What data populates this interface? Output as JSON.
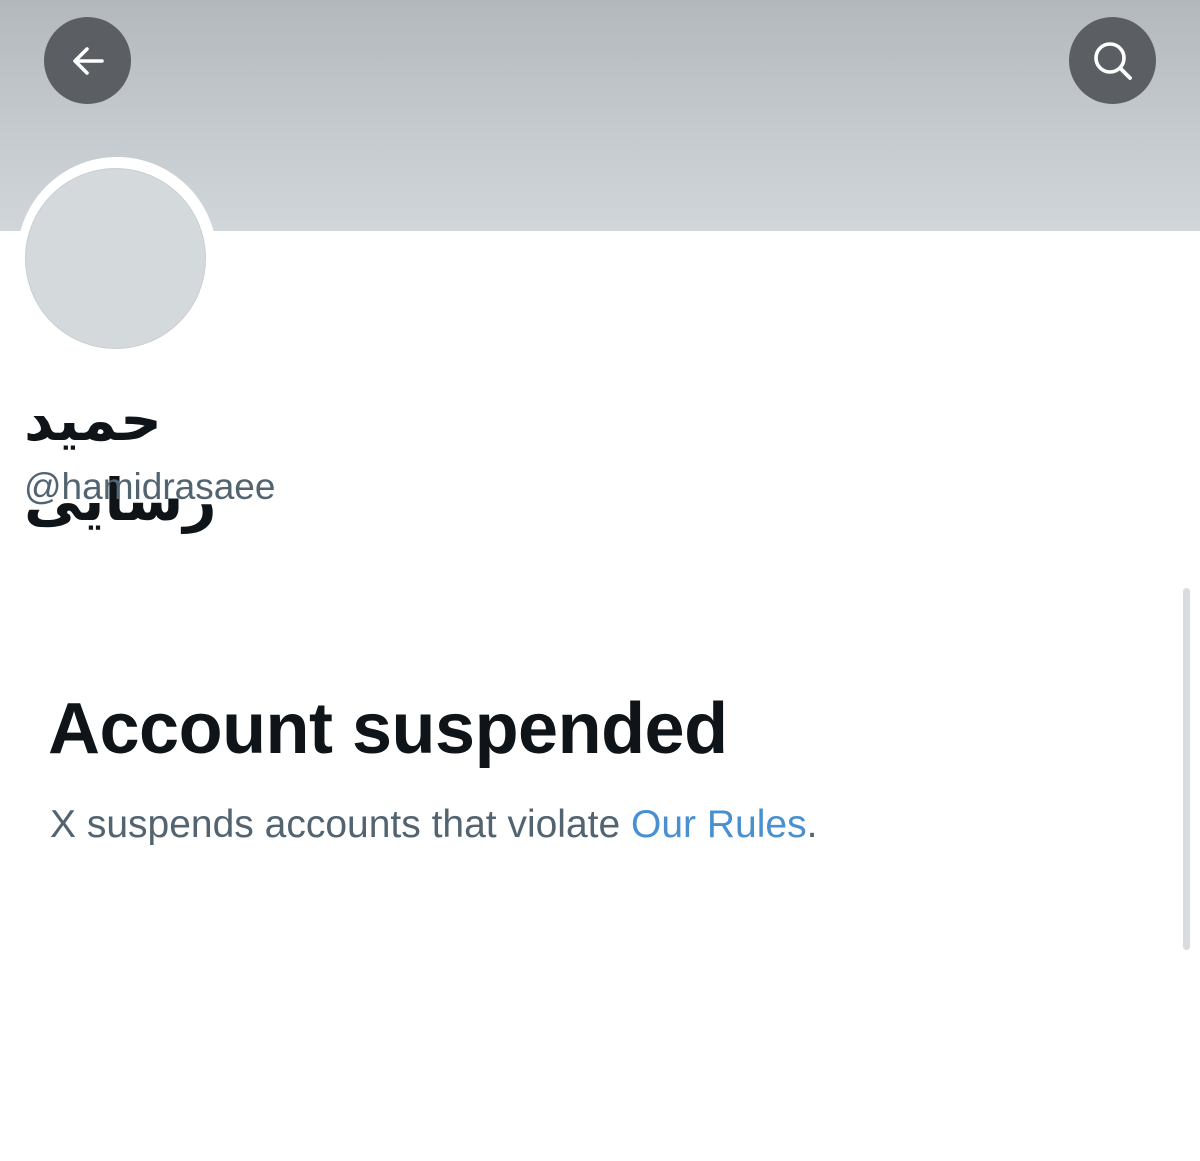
{
  "header": {
    "back_icon": "arrow-left-icon",
    "search_icon": "search-icon"
  },
  "profile": {
    "display_name": "حمید رسایی",
    "handle": "@hamidrasaee"
  },
  "notice": {
    "title": "Account suspended",
    "message_prefix": "X suspends accounts that violate ",
    "link_text": "Our Rules",
    "message_suffix": "."
  },
  "colors": {
    "banner": "#c4cacd",
    "button_bg": "#5b5f63",
    "link": "#4a90d0",
    "secondary_text": "#536471",
    "primary_text": "#0f1419"
  }
}
